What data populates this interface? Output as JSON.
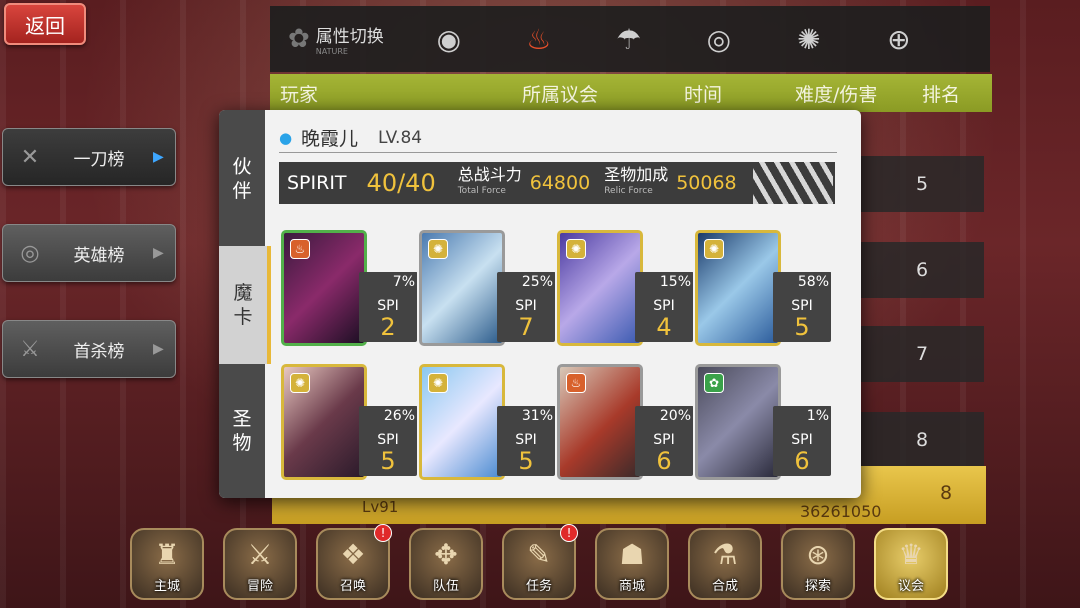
{
  "back_button": "返回",
  "side_tabs": [
    {
      "label": "一刀榜",
      "icon": "crossed-swords-icon"
    },
    {
      "label": "英雄榜",
      "icon": "medal-icon"
    },
    {
      "label": "首杀榜",
      "icon": "sword-icon"
    }
  ],
  "attribute_bar": {
    "title": "属性切换",
    "subtitle": "NATURE"
  },
  "table_header": {
    "player": "玩家",
    "council": "所属议会",
    "time": "时间",
    "difficulty": "难度/伤害",
    "rank": "排名"
  },
  "ranks": [
    "5",
    "6",
    "7",
    "8"
  ],
  "highlight_row": {
    "level": "Lv91",
    "score": "36261050",
    "rank": "8"
  },
  "bottom_menu": [
    {
      "label": "主城",
      "badge": ""
    },
    {
      "label": "冒险",
      "badge": ""
    },
    {
      "label": "召唤",
      "badge": "!"
    },
    {
      "label": "队伍",
      "badge": ""
    },
    {
      "label": "任务",
      "badge": "!"
    },
    {
      "label": "商城",
      "badge": ""
    },
    {
      "label": "合成",
      "badge": ""
    },
    {
      "label": "探索",
      "badge": ""
    },
    {
      "label": "议会",
      "badge": ""
    }
  ],
  "modal": {
    "tabs": [
      {
        "line1": "伙",
        "line2": "伴"
      },
      {
        "line1": "魔",
        "line2": "卡"
      },
      {
        "line1": "圣",
        "line2": "物"
      }
    ],
    "player_name": "晚霞儿",
    "player_level": "LV.84",
    "spirit_label": "SPIRIT",
    "spirit_value": "40/40",
    "total_force_cn": "总战斗力",
    "total_force_en": "Total Force",
    "total_force_value": "64800",
    "relic_force_cn": "圣物加成",
    "relic_force_en": "Relic Force",
    "relic_force_value": "50068",
    "spi_label": "SPI",
    "cards": [
      {
        "percent": "7%",
        "spi": "2"
      },
      {
        "percent": "25%",
        "spi": "7"
      },
      {
        "percent": "15%",
        "spi": "4"
      },
      {
        "percent": "58%",
        "spi": "5"
      },
      {
        "percent": "26%",
        "spi": "5"
      },
      {
        "percent": "31%",
        "spi": "5"
      },
      {
        "percent": "20%",
        "spi": "6"
      },
      {
        "percent": "1%",
        "spi": "6"
      }
    ]
  }
}
